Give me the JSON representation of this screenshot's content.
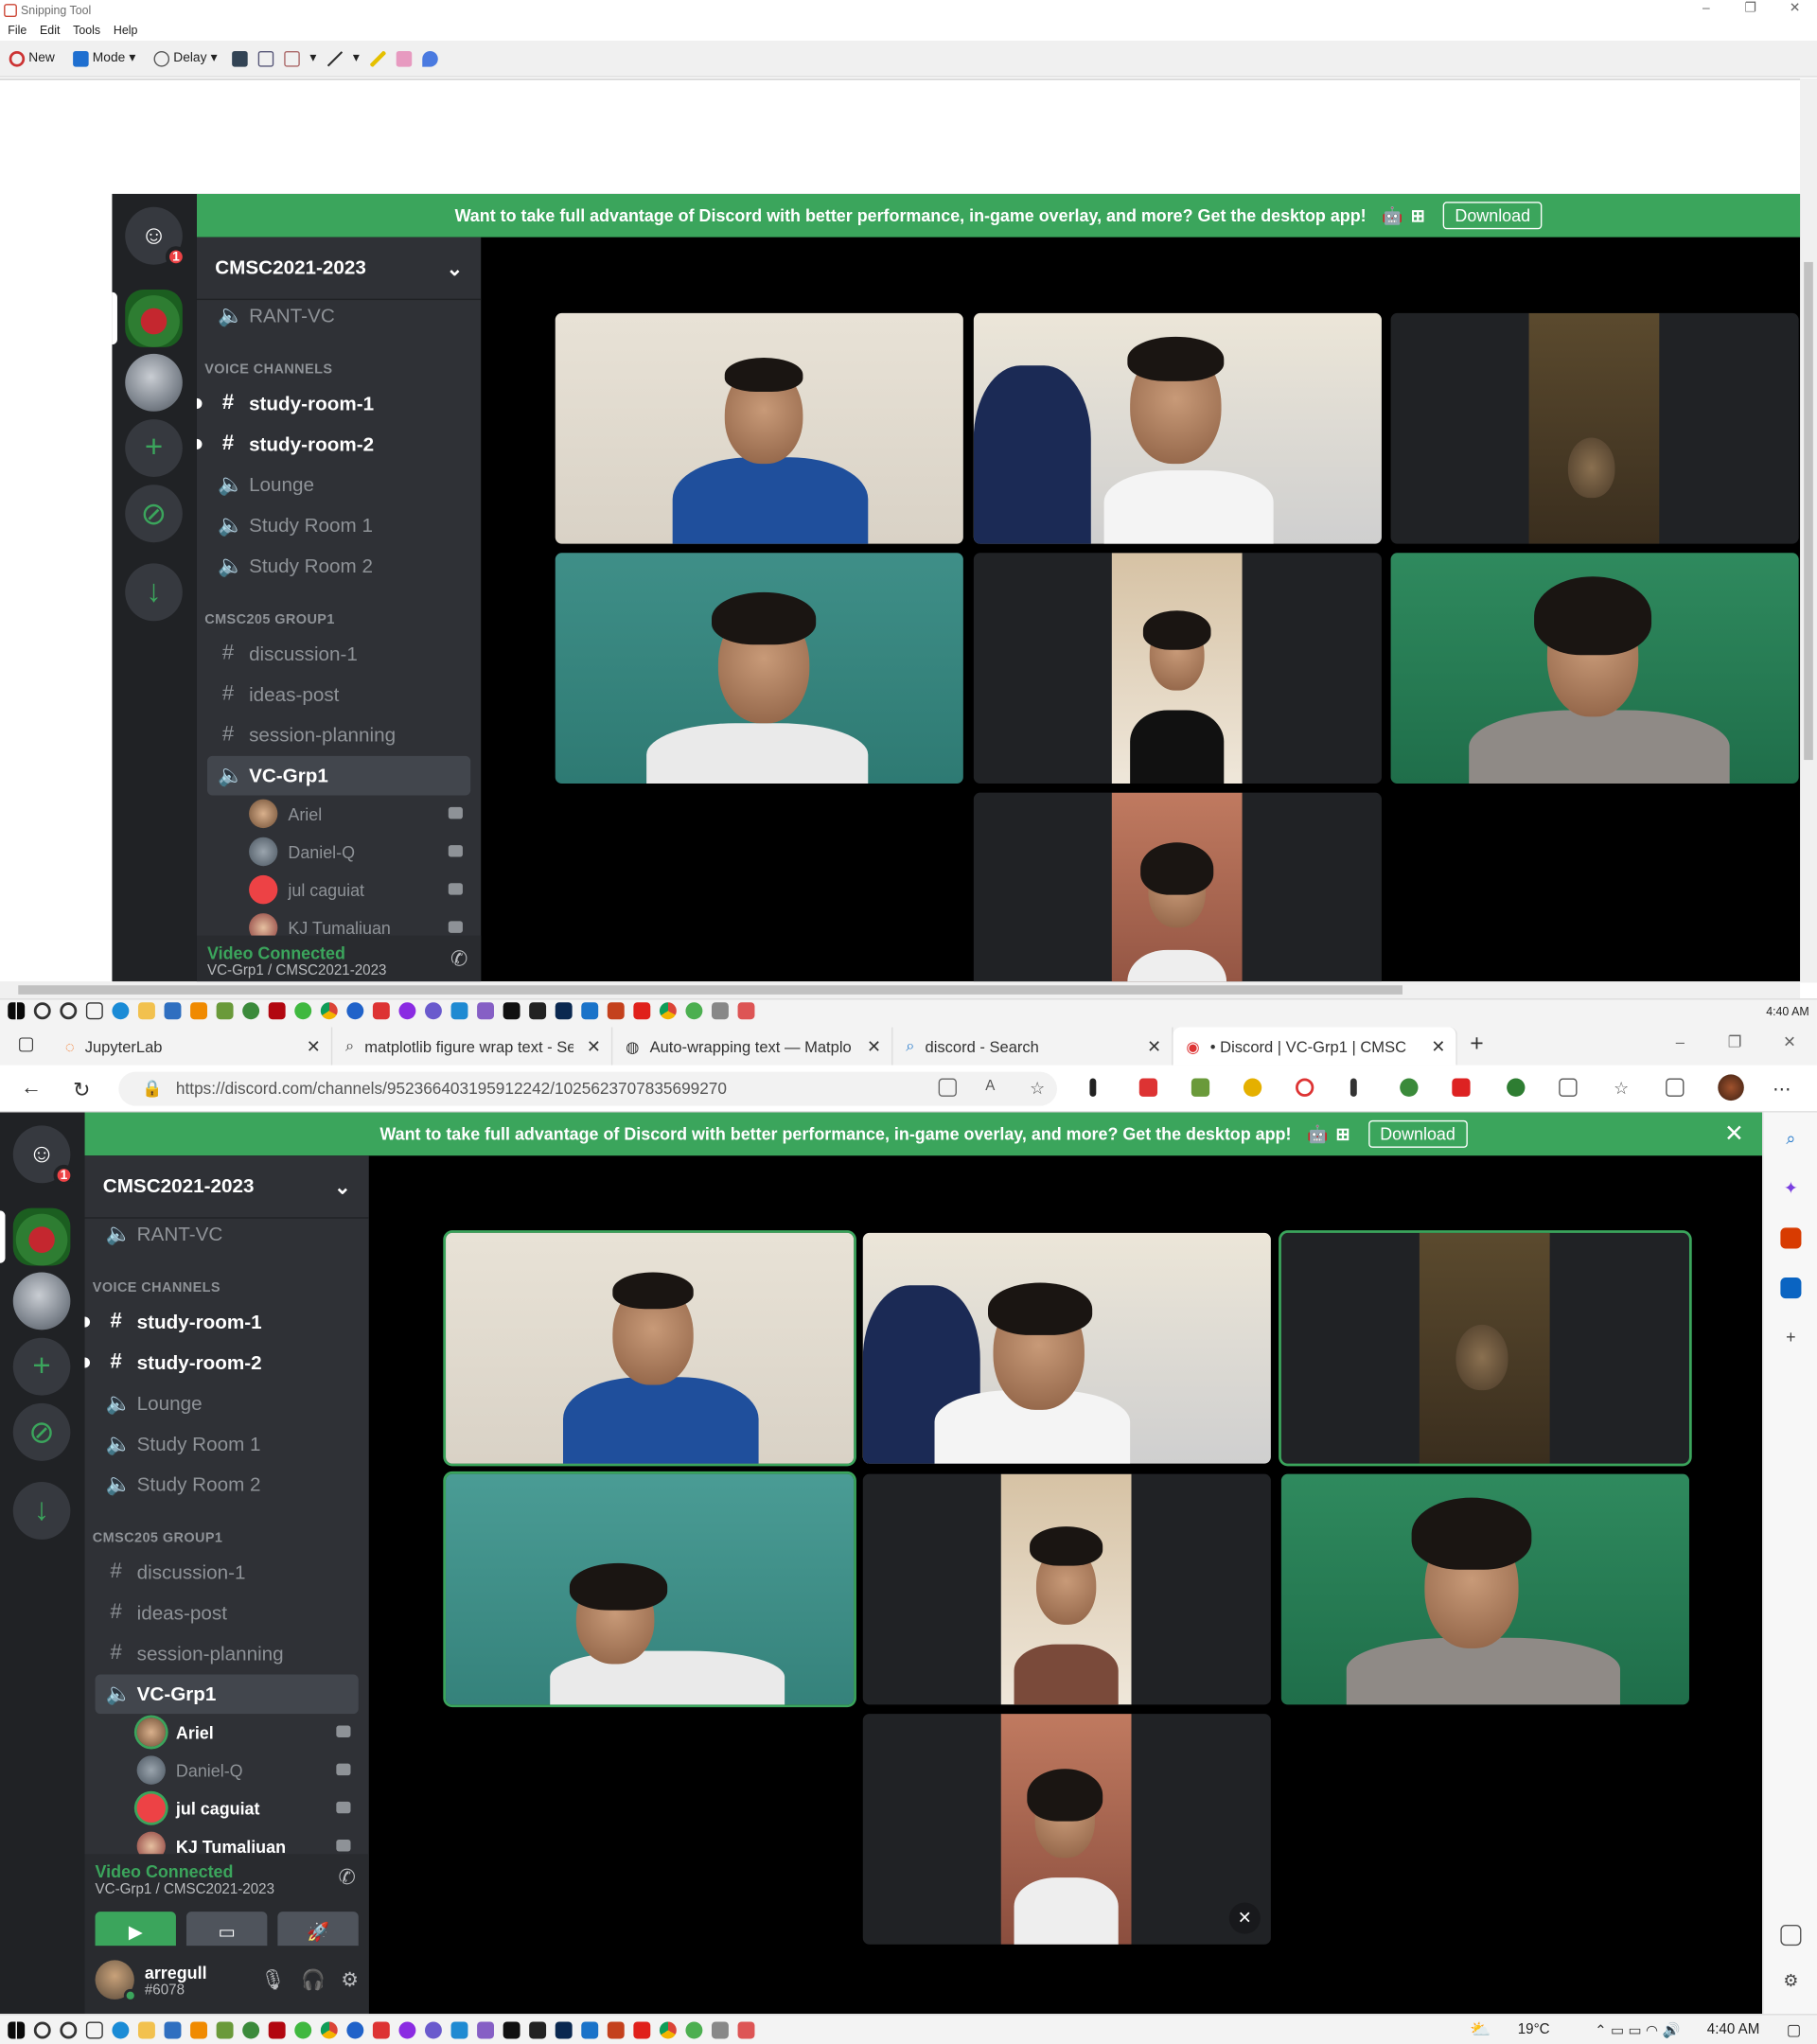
{
  "snipping_tool": {
    "title": "Snipping Tool",
    "menu": [
      "File",
      "Edit",
      "Tools",
      "Help"
    ],
    "toolbar": {
      "new": "New",
      "mode": "Mode",
      "delay": "Delay"
    }
  },
  "discord": {
    "banner_text": "Want to take full advantage of Discord with better performance, in-game overlay, and more? Get the desktop app!",
    "download_label": "Download",
    "home_badge": "1",
    "server_name": "CMSC2021-2023",
    "top_channel": "RANT-VC",
    "categories": [
      "VOICE CHANNELS",
      "CMSC205 GROUP1"
    ],
    "voice_channels": [
      "study-room-1",
      "study-room-2",
      "Lounge",
      "Study Room 1",
      "Study Room 2"
    ],
    "group_channels": [
      "discussion-1",
      "ideas-post",
      "session-planning",
      "VC-Grp1"
    ],
    "voice_users": [
      "Ariel",
      "Daniel-Q",
      "jul caguiat",
      "KJ Tumaliuan"
    ],
    "vc_status": "Video Connected",
    "vc_sub": "VC-Grp1 / CMSC2021-2023",
    "user": {
      "name": "arregull",
      "tag": "#6078"
    }
  },
  "taskbar_top": {
    "time": "4:40 AM"
  },
  "browser": {
    "tabs": [
      {
        "title": "JupyterLab"
      },
      {
        "title": "matplotlib figure wrap text - Sea"
      },
      {
        "title": "Auto-wrapping text — Matplotlib"
      },
      {
        "title": "discord - Search"
      },
      {
        "title": "• Discord | VC-Grp1 | CMSC"
      }
    ],
    "url": "https://discord.com/channels/952366403195912242/1025623707835699270"
  },
  "taskbar_bottom": {
    "weather": "19°C",
    "time": "4:40 AM"
  },
  "colors": {
    "discord_green": "#3ba55c",
    "sidebar": "#2f3136",
    "rail": "#202225"
  }
}
